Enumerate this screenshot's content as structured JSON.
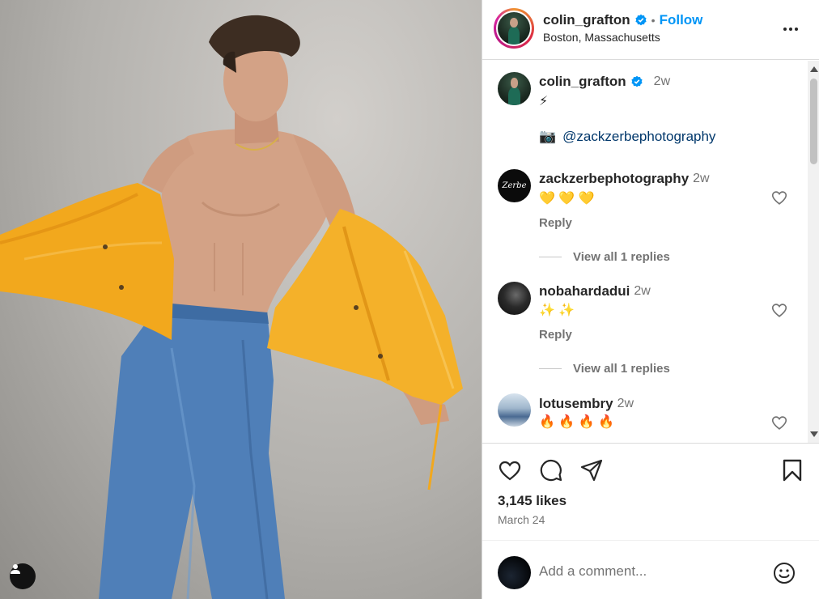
{
  "post": {
    "author": "colin_grafton",
    "location": "Boston, Massachusetts",
    "follow_label": "Follow",
    "dot": "•",
    "caption": {
      "time": "2w",
      "emoji": "⚡",
      "camera_emoji": "📷",
      "mention": "@zackzerbephotography"
    },
    "likes": "3,145 likes",
    "date": "March 24"
  },
  "comments": [
    {
      "user": "zackzerbephotography",
      "time": "2w",
      "text": "💛 💛 💛",
      "reply": "Reply",
      "view_replies": "View all 1 replies",
      "avatar_text": "Zerbe"
    },
    {
      "user": "nobahardadui",
      "time": "2w",
      "text": "✨ ✨",
      "reply": "Reply",
      "view_replies": "View all 1 replies"
    },
    {
      "user": "lotusembry",
      "time": "2w",
      "text": "🔥 🔥 🔥 🔥"
    }
  ],
  "add_comment": {
    "placeholder": "Add a comment..."
  },
  "colors": {
    "accent": "#0095f6",
    "verified": "#0095f6",
    "jacket": "#f2a81d",
    "jeans": "#4f7fb8"
  },
  "icons": [
    "verified-icon",
    "more-icon",
    "heart-icon",
    "comment-icon",
    "share-icon",
    "save-icon",
    "emoji-icon",
    "user-tag-icon"
  ]
}
